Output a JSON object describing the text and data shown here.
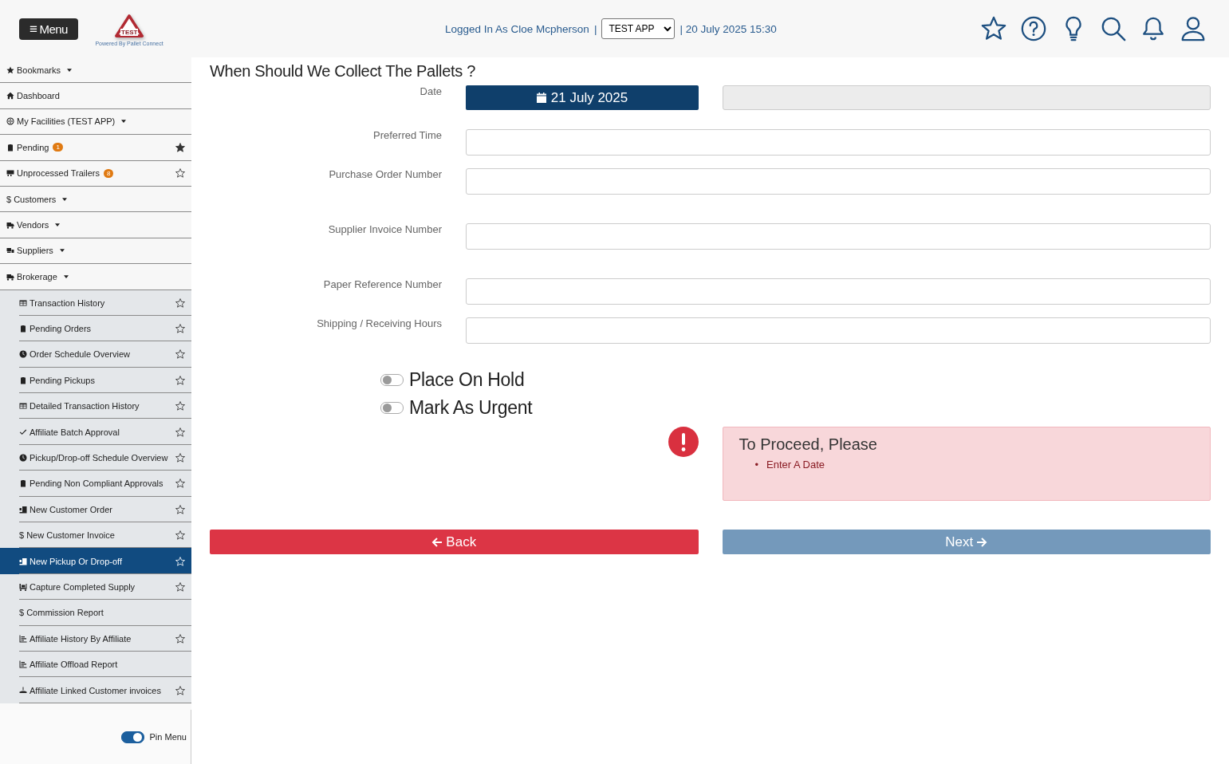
{
  "header": {
    "menu_icon": "≡",
    "menu_button": "Menu",
    "logo": {
      "badge": "TEST",
      "tagline": "Powered By Pallet Connect"
    },
    "user_text": "Logged In As Cloe Mcpherson",
    "separator": "|",
    "app_select": "TEST APP",
    "datetime": "| 20 July 2025 15:30"
  },
  "sidebar": {
    "items": [
      {
        "label": "Bookmarks",
        "expandable": true,
        "selected": false
      },
      {
        "label": "Dashboard",
        "expandable": false,
        "selected": false
      },
      {
        "label": "My Facilities (TEST APP)",
        "expandable": true,
        "selected": false
      },
      {
        "label": "Pending",
        "badge": "1",
        "starred": true,
        "expandable": false,
        "selected": false
      },
      {
        "label": "Unprocessed Trailers",
        "badge": "8",
        "starred": false,
        "expandable": false,
        "selected": false
      },
      {
        "label": "$ Customers",
        "expandable": true,
        "selected": false
      },
      {
        "label": "Vendors",
        "expandable": true,
        "selected": false
      },
      {
        "label": "Suppliers",
        "expandable": true,
        "selected": false
      },
      {
        "label": "Brokerage",
        "expandable": true,
        "selected": false,
        "children": [
          {
            "label": "Transaction History",
            "starred": false,
            "selected": false
          },
          {
            "label": "Pending Orders",
            "starred": false,
            "selected": false
          },
          {
            "label": "Order Schedule Overview",
            "starred": false,
            "selected": false
          },
          {
            "label": "Pending Pickups",
            "starred": false,
            "selected": false
          },
          {
            "label": "Detailed Transaction History",
            "starred": false,
            "selected": false
          },
          {
            "label": "Affiliate Batch Approval",
            "starred": false,
            "selected": false
          },
          {
            "label": "Pickup/Drop-off Schedule Overview",
            "starred": false,
            "selected": false
          },
          {
            "label": "Pending Non Compliant Approvals",
            "starred": false,
            "selected": false
          },
          {
            "label": "New Customer Order",
            "starred": false,
            "selected": false
          },
          {
            "label": "$ New Customer Invoice",
            "starred": false,
            "selected": false
          },
          {
            "label": "New Pickup Or Drop-off",
            "starred": false,
            "selected": true
          },
          {
            "label": "Capture Completed Supply",
            "starred": false,
            "selected": false
          },
          {
            "label": "$ Commission Report",
            "selected": false
          },
          {
            "label": "Affiliate History By Affiliate",
            "starred": false,
            "selected": false
          },
          {
            "label": "Affiliate Offload Report",
            "selected": false
          },
          {
            "label": "Affiliate Linked Customer invoices",
            "starred": false,
            "selected": false
          }
        ]
      }
    ],
    "pin_menu": {
      "label": "Pin Menu",
      "on": true
    }
  },
  "form": {
    "title": "When Should We Collect The Pallets ?",
    "fields": [
      {
        "label": "Date",
        "kind": "date",
        "value": "21 July 2025"
      },
      {
        "label": "Preferred Time",
        "kind": "text"
      },
      {
        "label": "Purchase Order Number",
        "kind": "text"
      },
      {
        "label": "Supplier Invoice Number",
        "kind": "text"
      },
      {
        "label": "Paper Reference Number",
        "kind": "text"
      },
      {
        "label": "Shipping / Receiving Hours",
        "kind": "text"
      }
    ],
    "toggles": [
      {
        "label": "Place On Hold",
        "on": false
      },
      {
        "label": "Mark As Urgent",
        "on": false
      }
    ],
    "alert": {
      "title": "To Proceed, Please",
      "bullet": "•",
      "items": [
        "Enter A Date"
      ]
    },
    "buttons": [
      {
        "label": "Back",
        "kind": "back"
      },
      {
        "label": "Next",
        "kind": "next"
      }
    ]
  }
}
